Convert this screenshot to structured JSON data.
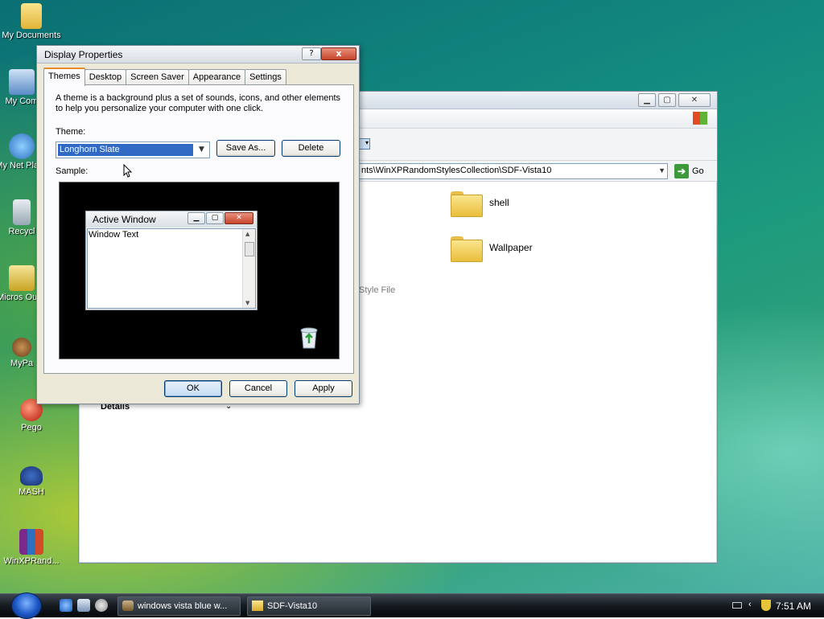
{
  "desktop": {
    "icons": [
      {
        "label": "My Documents",
        "icon": "folder-icon"
      },
      {
        "label": "My Com",
        "icon": "computer-icon"
      },
      {
        "label": "My Net Place",
        "icon": "network-icon"
      },
      {
        "label": "Recycl",
        "icon": "recycle-bin-icon"
      },
      {
        "label": "Micros Outlo",
        "icon": "outlook-icon"
      },
      {
        "label": "MyPa",
        "icon": "app-shortcut-icon"
      },
      {
        "label": "Pego",
        "icon": "app-shortcut-icon"
      },
      {
        "label": "MASH",
        "icon": "app-shortcut-icon"
      },
      {
        "label": "WinXPRand...",
        "icon": "archive-icon"
      }
    ]
  },
  "explorer": {
    "address": "nts\\WinXPRandomStylesCollection\\SDF-Vista10",
    "go_label": "Go",
    "folders": [
      {
        "name": "shell"
      },
      {
        "name": "Wallpaper"
      }
    ],
    "partial_text": "Style File",
    "details_label": "Details"
  },
  "dialog": {
    "title": "Display Properties",
    "help_label": "?",
    "close_label": "x",
    "tabs": [
      "Themes",
      "Desktop",
      "Screen Saver",
      "Appearance",
      "Settings"
    ],
    "active_tab": "Themes",
    "description": "A theme is a background plus a set of sounds, icons, and other elements to help you personalize your computer with one click.",
    "theme_label": "Theme:",
    "theme_value": "Longhorn Slate",
    "save_as_label": "Save As...",
    "delete_label": "Delete",
    "sample_label": "Sample:",
    "sample_window": {
      "title": "Active Window",
      "body_text": "Window Text"
    },
    "ok_label": "OK",
    "cancel_label": "Cancel",
    "apply_label": "Apply"
  },
  "taskbar": {
    "tasks": [
      {
        "label": "windows vista blue w..."
      },
      {
        "label": "SDF-Vista10"
      }
    ],
    "clock": "7:51 AM"
  },
  "colors": {
    "selection": "#316ac5",
    "dialog_bg": "#ece9d8",
    "active_tab_accent": "#e68b2c"
  }
}
